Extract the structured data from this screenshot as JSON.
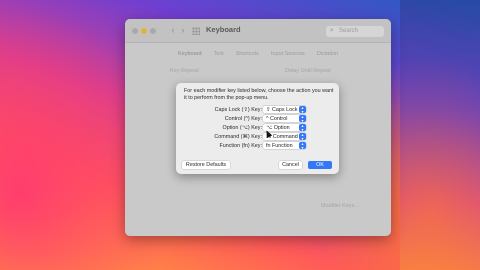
{
  "window": {
    "title": "Keyboard",
    "nav_back": "‹",
    "nav_forward": "›",
    "search_placeholder": "Search",
    "tabs": [
      "Keyboard",
      "Text",
      "Shortcuts",
      "Input Sources",
      "Dictation"
    ],
    "active_tab": 0,
    "left_pane_label": "Key Repeat",
    "right_pane_label": "Delay Until Repeat",
    "modifier_keys_button": "Modifier Keys..."
  },
  "dialog": {
    "instructions": "For each modifier key listed below, choose the action you want it to perform from the pop-up menu.",
    "rows": [
      {
        "label": "Caps Lock (⇪) Key:",
        "value": "⇪ Caps Lock"
      },
      {
        "label": "Control (^) Key:",
        "value": "^ Control"
      },
      {
        "label": "Option (⌥) Key:",
        "value": "⌥ Option"
      },
      {
        "label": "Command (⌘) Key:",
        "value": "⌘ Command"
      },
      {
        "label": "Function (fn) Key:",
        "value": "fn Function"
      }
    ],
    "restore_defaults": "Restore Defaults",
    "cancel": "Cancel",
    "ok": "OK"
  },
  "colors": {
    "accent": "#3478f6",
    "window_bg": "#c9c9c9",
    "dialog_bg": "#ececec"
  }
}
